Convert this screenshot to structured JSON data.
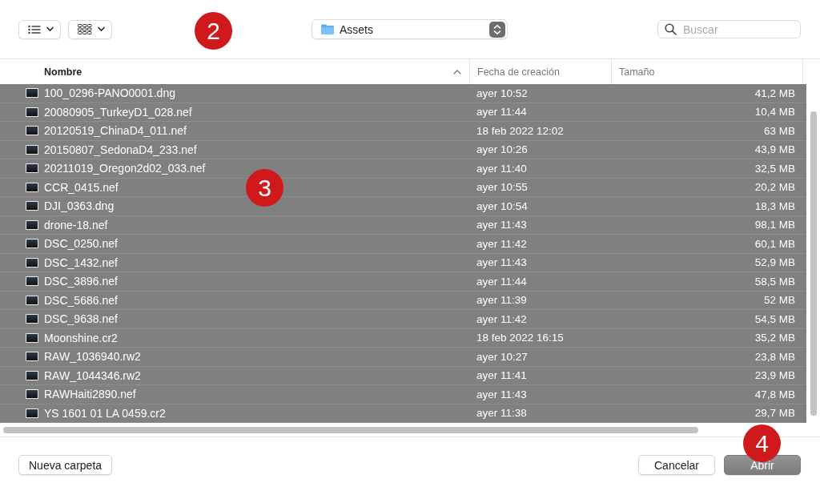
{
  "toolbar": {
    "view_buttons": [
      {
        "kind": "list"
      },
      {
        "kind": "grid"
      }
    ],
    "location": {
      "label": "Assets"
    },
    "search": {
      "placeholder": "Buscar"
    }
  },
  "columns": [
    {
      "label": "Nombre",
      "sorted": true
    },
    {
      "label": "Fecha de creación",
      "sorted": false
    },
    {
      "label": "Tamaño",
      "sorted": false
    }
  ],
  "rows": [
    {
      "name": "100_0296-PANO0001.dng",
      "date": "ayer 10:52",
      "size": "41,2 MB",
      "selected": true
    },
    {
      "name": "20080905_TurkeyD1_028.nef",
      "date": "ayer 11:44",
      "size": "10,4 MB",
      "selected": true
    },
    {
      "name": "20120519_ChinaD4_011.nef",
      "date": "18 feb 2022 12:02",
      "size": "63 MB",
      "selected": true
    },
    {
      "name": "20150807_SedonaD4_233.nef",
      "date": "ayer 10:26",
      "size": "43,9 MB",
      "selected": true
    },
    {
      "name": "20211019_Oregon2d02_033.nef",
      "date": "ayer 11:40",
      "size": "32,5 MB",
      "selected": true
    },
    {
      "name": "CCR_0415.nef",
      "date": "ayer 10:55",
      "size": "20,2 MB",
      "selected": true
    },
    {
      "name": "DJI_0363.dng",
      "date": "ayer 10:54",
      "size": "18,3 MB",
      "selected": true
    },
    {
      "name": "drone-18.nef",
      "date": "ayer 11:43",
      "size": "98,1 MB",
      "selected": true
    },
    {
      "name": "DSC_0250.nef",
      "date": "ayer 11:42",
      "size": "60,1 MB",
      "selected": true
    },
    {
      "name": "DSC_1432.nef",
      "date": "ayer 11:43",
      "size": "52,9 MB",
      "selected": true
    },
    {
      "name": "DSC_3896.nef",
      "date": "ayer 11:44",
      "size": "58,5 MB",
      "selected": true
    },
    {
      "name": "DSC_5686.nef",
      "date": "ayer 11:39",
      "size": "52 MB",
      "selected": true
    },
    {
      "name": "DSC_9638.nef",
      "date": "ayer 11:42",
      "size": "54,5 MB",
      "selected": true
    },
    {
      "name": "Moonshine.cr2",
      "date": "18 feb 2022 16:15",
      "size": "35,2 MB",
      "selected": true
    },
    {
      "name": "RAW_1036940.rw2",
      "date": "ayer 10:27",
      "size": "23,8 MB",
      "selected": true
    },
    {
      "name": "RAW_1044346.rw2",
      "date": "ayer 11:41",
      "size": "23,9 MB",
      "selected": true
    },
    {
      "name": "RAWHaiti2890.nef",
      "date": "ayer 11:43",
      "size": "47,8 MB",
      "selected": true
    },
    {
      "name": "YS 1601 01 LA 0459.cr2",
      "date": "ayer 11:38",
      "size": "29,7 MB",
      "selected": true
    }
  ],
  "buttons": [
    {
      "label": "Nueva carpeta",
      "kind": "secondary"
    },
    {
      "label": "Cancelar",
      "kind": "secondary"
    },
    {
      "label": "Abrir",
      "kind": "default"
    }
  ],
  "callouts": [
    {
      "label": "2"
    },
    {
      "label": "3"
    },
    {
      "label": "4"
    }
  ]
}
